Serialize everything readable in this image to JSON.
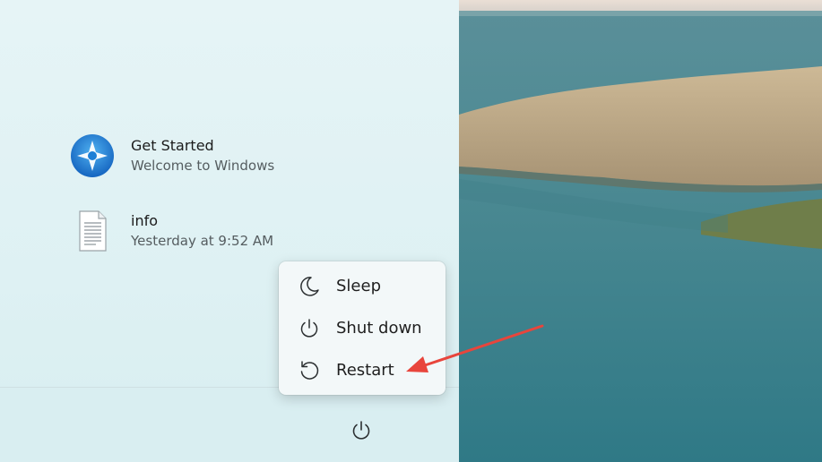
{
  "recommended": [
    {
      "title": "Get Started",
      "subtitle": "Welcome to Windows",
      "icon": "get-started-icon"
    },
    {
      "title": "info",
      "subtitle": "Yesterday at 9:52 AM",
      "icon": "text-document-icon"
    }
  ],
  "power_menu": {
    "items": [
      {
        "label": "Sleep",
        "icon": "moon-icon"
      },
      {
        "label": "Shut down",
        "icon": "power-icon"
      },
      {
        "label": "Restart",
        "icon": "restart-icon"
      }
    ]
  },
  "footer": {
    "power_button_icon": "power-icon"
  },
  "colors": {
    "accent": "#1a73c9",
    "annotation_arrow": "#e8453c"
  }
}
